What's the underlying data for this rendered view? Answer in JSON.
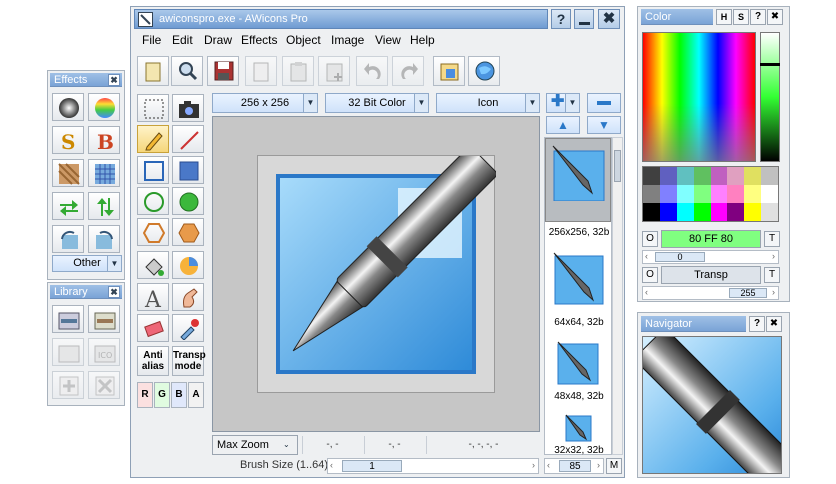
{
  "window": {
    "title": "awiconspro.exe - AWicons Pro"
  },
  "menu": [
    "File",
    "Edit",
    "Draw",
    "Effects",
    "Object",
    "Image",
    "View",
    "Help"
  ],
  "toolbar_dropdowns": {
    "size": "256 x 256",
    "color_depth": "32 Bit Color",
    "format": "Icon"
  },
  "effects_panel": {
    "title": "Effects",
    "other_label": "Other"
  },
  "library_panel": {
    "title": "Library"
  },
  "color_panel": {
    "title": "Color",
    "hex_value": "80 FF 80",
    "transp_label": "Transp",
    "slider1_value": "0",
    "slider2_value": "255",
    "o_label": "O",
    "t_label": "T"
  },
  "navigator_panel": {
    "title": "Navigator"
  },
  "tools": {
    "antialias": "Anti alias",
    "transp_mode": "Transp mode",
    "channels": [
      "R",
      "G",
      "B",
      "A"
    ]
  },
  "thumbnails": [
    "256x256, 32b",
    "64x64, 32b",
    "48x48, 32b",
    "32x32, 32b"
  ],
  "status": {
    "zoom": "Max Zoom",
    "cell1": "-, -",
    "cell2": "-, -",
    "cell3": "-, -, -, -"
  },
  "brush": {
    "label": "Brush Size (1..64)",
    "value": "1"
  },
  "list_zoom": {
    "value": "85",
    "m_label": "M"
  },
  "title_buttons": [
    "?",
    "_",
    "x"
  ],
  "colors": {
    "titlebar": "#7aa3d6",
    "canvas_bg": "#c6c6c6",
    "accent": "#3b8fd8",
    "selected_color": "#80ff80"
  }
}
